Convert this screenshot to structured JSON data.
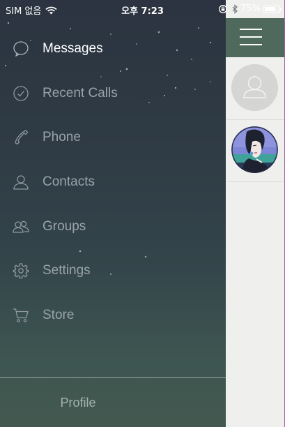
{
  "status_bar": {
    "carrier": "SIM 없음",
    "time": "오후 7:23",
    "battery_percent": "75%",
    "battery_level": 0.75
  },
  "menu": {
    "items": [
      {
        "label": "Messages",
        "icon": "chat-bubble-icon",
        "active": true
      },
      {
        "label": "Recent Calls",
        "icon": "clock-icon",
        "active": false
      },
      {
        "label": "Phone",
        "icon": "phone-icon",
        "active": false
      },
      {
        "label": "Contacts",
        "icon": "person-icon",
        "active": false
      },
      {
        "label": "Groups",
        "icon": "group-icon",
        "active": false
      },
      {
        "label": "Settings",
        "icon": "gear-icon",
        "active": false
      },
      {
        "label": "Store",
        "icon": "cart-icon",
        "active": false
      }
    ]
  },
  "profile": {
    "label": "Profile"
  },
  "colors": {
    "drawer_top": "#2b3440",
    "drawer_bottom": "#43594f",
    "panel_header": "#4f6a5c",
    "active_text": "#ffffff",
    "inactive_text": "#9aa3a9"
  }
}
